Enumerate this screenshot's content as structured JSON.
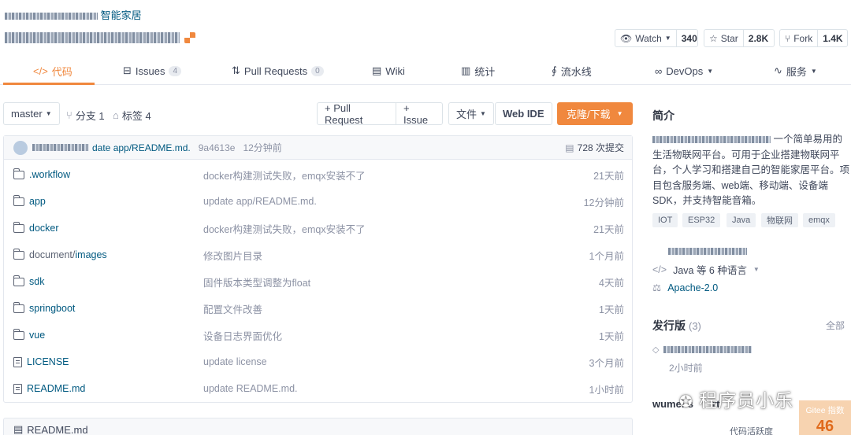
{
  "header": {
    "breadcrumb_category": "智能家居",
    "watch": {
      "label": "Watch",
      "count": "340"
    },
    "star": {
      "label": "Star",
      "count": "2.8K"
    },
    "fork": {
      "label": "Fork",
      "count": "1.4K"
    }
  },
  "tabs": [
    {
      "label": "代码",
      "icon": "code-icon"
    },
    {
      "label": "Issues",
      "count": "4",
      "icon": "issues-icon"
    },
    {
      "label": "Pull Requests",
      "count": "0",
      "icon": "pull-request-icon"
    },
    {
      "label": "Wiki",
      "icon": "wiki-icon"
    },
    {
      "label": "统计",
      "icon": "chart-icon"
    },
    {
      "label": "流水线",
      "icon": "pipeline-icon"
    },
    {
      "label": "DevOps",
      "icon": "devops-icon"
    },
    {
      "label": "服务",
      "icon": "service-icon"
    }
  ],
  "toolbar": {
    "branch": "master",
    "branches": "分支 1",
    "tags": "标签 4",
    "pull_request": "+ Pull Request",
    "issue": "+ Issue",
    "file": "文件",
    "web_ide": "Web IDE",
    "clone": "克隆/下载"
  },
  "commit": {
    "message": "date app/README.md.",
    "hash": "9a4613e",
    "time": "12分钟前",
    "total": "728 次提交"
  },
  "files": [
    {
      "type": "folder",
      "name": ".workflow",
      "message": "docker构建测试失败，emqx安装不了",
      "time": "21天前"
    },
    {
      "type": "folder",
      "name": "app",
      "message": "update app/README.md.",
      "time": "12分钟前"
    },
    {
      "type": "folder",
      "name": "docker",
      "message": "docker构建测试失败，emqx安装不了",
      "time": "21天前"
    },
    {
      "type": "folder",
      "name": "document/",
      "name_tail": "images",
      "message": "修改图片目录",
      "time": "1个月前"
    },
    {
      "type": "folder",
      "name": "sdk",
      "message": "固件版本类型调整为float",
      "time": "4天前"
    },
    {
      "type": "folder",
      "name": "springboot",
      "message": "配置文件改善",
      "time": "1天前"
    },
    {
      "type": "folder",
      "name": "vue",
      "message": "设备日志界面优化",
      "time": "1天前"
    },
    {
      "type": "file",
      "name": "LICENSE",
      "message": "update license",
      "time": "3个月前"
    },
    {
      "type": "file",
      "name": "README.md",
      "message": "update README.md.",
      "time": "1小时前"
    }
  ],
  "readme_label": "README.md",
  "sidebar": {
    "intro_title": "简介",
    "intro_text": "一个简单易用的生活物联网平台。可用于企业搭建物联网平台，个人学习和搭建自己的智能家居平台。项目包含服务端、web端、移动端、设备端SDK，并支持智能音箱。",
    "topics": [
      "IOT",
      "ESP32",
      "Java",
      "物联网",
      "emqx"
    ],
    "language": "Java 等 6 种语言",
    "license": "Apache-2.0",
    "releases_title": "发行版",
    "releases_count": "(3)",
    "releases_all": "全部",
    "release_time": "2小时前",
    "contributors_prefix": "wumei-s",
    "contributors_suffix": "rt",
    "activity_label": "代码活跃度"
  },
  "gitee_index": {
    "label": "Gitee 指数",
    "value": "46"
  },
  "watermark": "程序员小乐",
  "colors": {
    "accent": "#f0883e",
    "link": "#005980",
    "muted": "#8c92a4"
  }
}
